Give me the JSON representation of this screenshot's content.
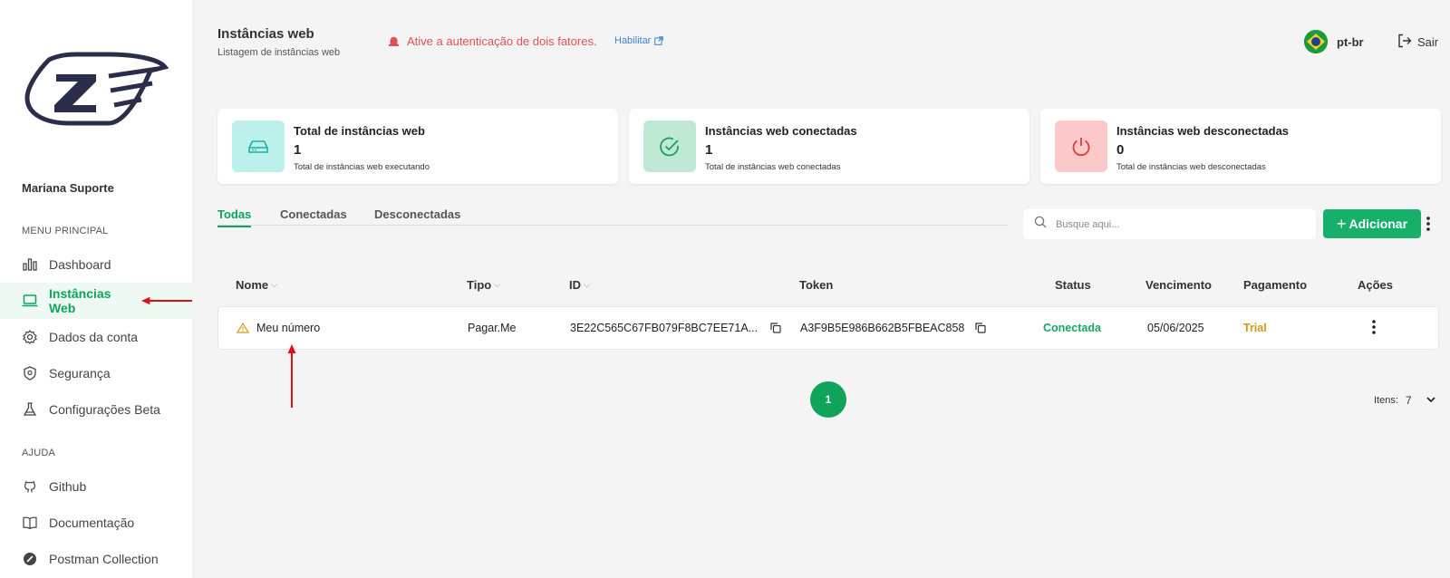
{
  "sidebar": {
    "user_name": "Mariana Suporte",
    "main_menu_label": "MENU PRINCIPAL",
    "help_label": "AJUDA",
    "items": [
      {
        "label": "Dashboard",
        "icon": "chart-bars-icon"
      },
      {
        "label": "Instâncias Web",
        "icon": "laptop-icon",
        "active": true
      },
      {
        "label": "Dados da conta",
        "icon": "gear-icon"
      },
      {
        "label": "Segurança",
        "icon": "shield-icon"
      },
      {
        "label": "Configurações Beta",
        "icon": "flask-icon"
      }
    ],
    "help_items": [
      {
        "label": "Github",
        "icon": "github-icon"
      },
      {
        "label": "Documentação",
        "icon": "book-icon"
      },
      {
        "label": "Postman Collection",
        "icon": "postman-icon"
      }
    ]
  },
  "header": {
    "title": "Instâncias web",
    "subtitle": "Listagem de instâncias web",
    "two_fa_warning": "Ative a autenticação de dois fatores.",
    "enable_link": "Habilitar",
    "language": "pt-br",
    "logout": "Sair"
  },
  "cards": [
    {
      "title": "Total de instâncias web",
      "value": "1",
      "description": "Total de instâncias web executando",
      "color": "#bdf0ea"
    },
    {
      "title": "Instâncias web conectadas",
      "value": "1",
      "description": "Total de instâncias web conectadas",
      "color": "#bfe9d4"
    },
    {
      "title": "Instâncias web desconectadas",
      "value": "0",
      "description": "Total de instâncias web desconectadas",
      "color": "#fbc9c9"
    }
  ],
  "tabs": [
    "Todas",
    "Conectadas",
    "Desconectadas"
  ],
  "search": {
    "placeholder": "Busque aqui..."
  },
  "add_button": "Adicionar",
  "table": {
    "columns": [
      "Nome",
      "Tipo",
      "ID",
      "Token",
      "Status",
      "Vencimento",
      "Pagamento",
      "Ações"
    ],
    "rows": [
      {
        "name": "Meu número",
        "type": "Pagar.Me",
        "id": "3E22C565C67FB079F8BC7EE71A...",
        "token": "A3F9B5E986B662B5FBEAC858",
        "status": "Conectada",
        "due": "05/06/2025",
        "payment": "Trial"
      }
    ]
  },
  "pagination": {
    "current_page": "1",
    "items_label": "Itens:",
    "items_value": "7"
  },
  "colors": {
    "accent": "#16b06a",
    "warning": "#e05050",
    "trial": "#d19a12"
  }
}
